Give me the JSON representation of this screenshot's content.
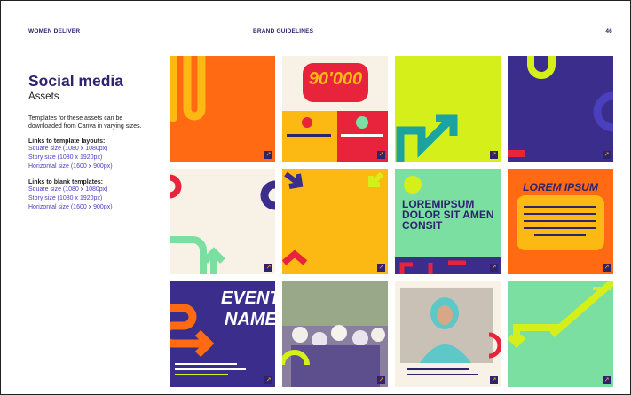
{
  "header": {
    "org": "WOMEN DELIVER",
    "doc_title": "BRAND GUIDELINES",
    "page_number": "46"
  },
  "sidebar": {
    "title": "Social media",
    "subtitle": "Assets",
    "description": "Templates for these assets can be downloaded from Canva in varying sizes.",
    "layouts_heading": "Links to template layouts:",
    "layout_links": [
      "Square size (1080 x 1080px)",
      "Story size (1080 x 1920px)",
      "Horizontal size (1600 x 900px)"
    ],
    "blank_heading": "Links to blank templates:",
    "blank_links": [
      "Square size (1080 x 1080px)",
      "Story size (1080 x 1920px)",
      "Horizontal size (1600 x 900px)"
    ]
  },
  "tiles": {
    "t2_number": "90'000",
    "t7_heading": "LOREMIPSUM DOLOR SIT AMEN CONSIT",
    "t8_heading": "LOREM IPSUM",
    "t9_heading_1": "EVENT",
    "t9_heading_2": "NAME"
  },
  "colors": {
    "navy": "#2d2470",
    "orange": "#ff6a13",
    "lime": "#d4ef1a",
    "cream": "#f7f1e6",
    "yellow": "#fdb913",
    "green": "#7adfa0",
    "red": "#e8233c",
    "purple": "#3a2d8c"
  }
}
